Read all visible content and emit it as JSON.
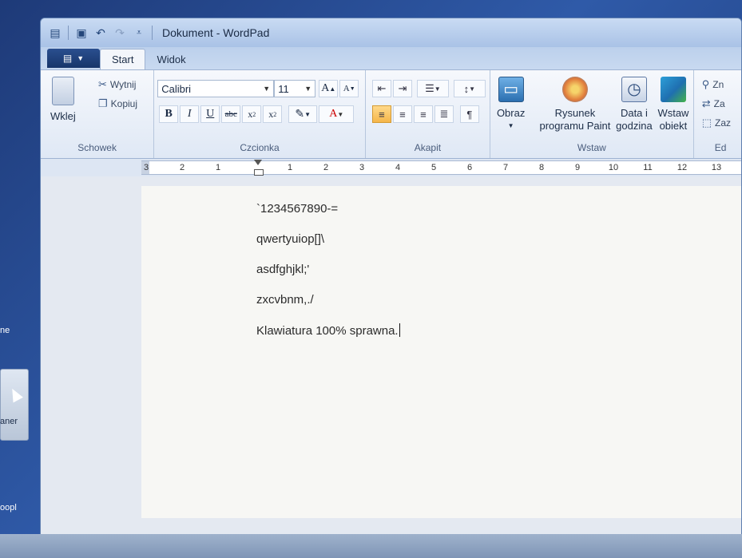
{
  "window": {
    "title": "Dokument - WordPad"
  },
  "tabs": [
    {
      "label": "Start"
    },
    {
      "label": "Widok"
    }
  ],
  "clipboard": {
    "paste": "Wklej",
    "cut": "Wytnij",
    "copy": "Kopiuj",
    "group": "Schowek"
  },
  "font": {
    "family": "Calibri",
    "size": "11",
    "group": "Czcionka"
  },
  "paragraph": {
    "group": "Akapit"
  },
  "insert": {
    "image": "Obraz",
    "paint_line1": "Rysunek",
    "paint_line2": "programu Paint",
    "date_line1": "Data i",
    "date_line2": "godzina",
    "object_line1": "Wstaw",
    "object_line2": "obiekt",
    "group": "Wstaw"
  },
  "editing": {
    "find": "Zn",
    "replace": "Za",
    "select_all": "Zaz",
    "group": "Ed"
  },
  "ruler": {
    "numbers": [
      "3",
      "2",
      "1",
      "1",
      "2",
      "3",
      "4",
      "5",
      "6",
      "7",
      "8",
      "9",
      "10",
      "11",
      "12",
      "13"
    ]
  },
  "document": {
    "lines": [
      "`1234567890-=",
      "qwertyuiop[]\\",
      "asdfghjkl;'",
      "zxcvbnm,./",
      "Klawiatura 100% sprawna."
    ]
  },
  "desktop": {
    "fragment1": "ne",
    "fragment2": "aner",
    "fragment3": "oopl"
  }
}
